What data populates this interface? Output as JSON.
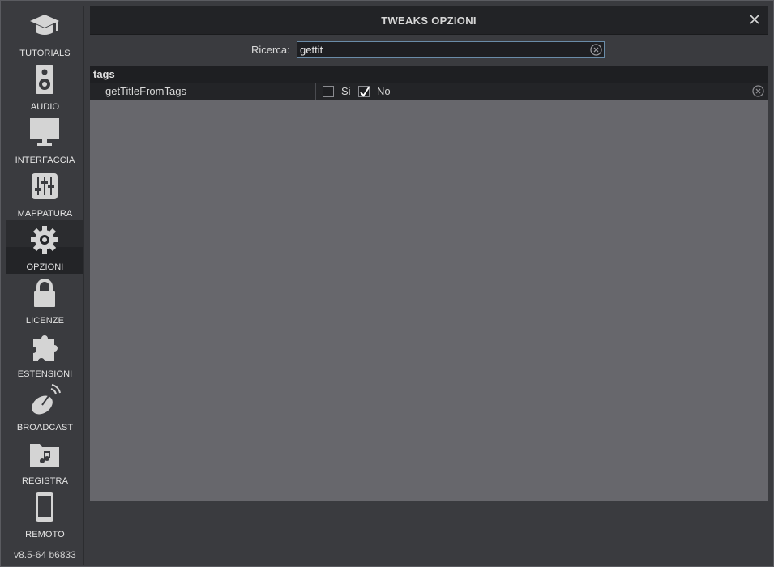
{
  "window": {
    "title": "TWEAKS OPZIONI"
  },
  "sidebar": {
    "items": [
      {
        "label": "TUTORIALS",
        "icon": "graduation-cap-icon",
        "active": false
      },
      {
        "label": "AUDIO",
        "icon": "speaker-icon",
        "active": false
      },
      {
        "label": "INTERFACCIA",
        "icon": "monitor-icon",
        "active": false
      },
      {
        "label": "MAPPATURA",
        "icon": "sliders-icon",
        "active": false
      },
      {
        "label": "OPZIONI",
        "icon": "gear-icon",
        "active": true
      },
      {
        "label": "LICENZE",
        "icon": "lock-icon",
        "active": false
      },
      {
        "label": "ESTENSIONI",
        "icon": "puzzle-icon",
        "active": false
      },
      {
        "label": "BROADCAST",
        "icon": "satellite-dish-icon",
        "active": false
      },
      {
        "label": "REGISTRA",
        "icon": "music-folder-icon",
        "active": false
      },
      {
        "label": "REMOTO",
        "icon": "phone-icon",
        "active": false
      }
    ],
    "version": "v8.5-64 b6833"
  },
  "search": {
    "label": "Ricerca:",
    "value": "gettit"
  },
  "group": {
    "name": "tags"
  },
  "rows": [
    {
      "name": "getTitleFromTags",
      "option_yes": "Si",
      "option_no": "No",
      "yes_checked": false,
      "no_checked": true
    }
  ],
  "colors": {
    "accent_border": "#6a8ca8",
    "panel": "#67676c",
    "background": "#3a3b3f"
  }
}
